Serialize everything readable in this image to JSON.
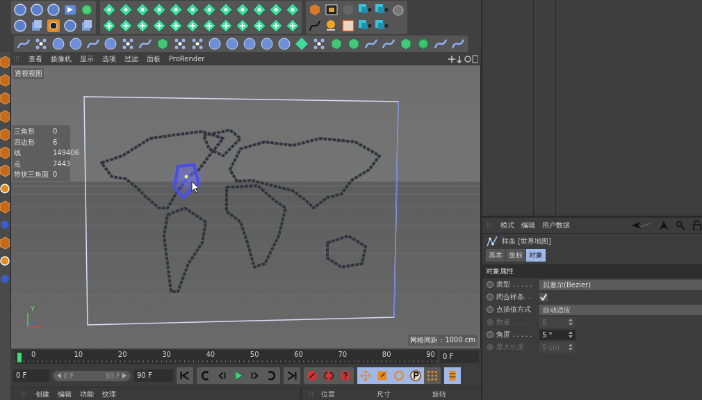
{
  "viewport": {
    "menu": [
      "查看",
      "摄像机",
      "显示",
      "选项",
      "过滤",
      "面板",
      "ProRender"
    ],
    "view_name": "透视视图",
    "stats": [
      {
        "label": "三角形",
        "value": "0"
      },
      {
        "label": "四边形",
        "value": "6"
      },
      {
        "label": "线",
        "value": "149406"
      },
      {
        "label": "点",
        "value": "7443"
      },
      {
        "label": "带状三角面",
        "value": "0"
      }
    ],
    "axis_label": "Y",
    "grid_spacing": "网格间距 : 1000 cm"
  },
  "timeline": {
    "ticks": [
      "0",
      "10",
      "20",
      "30",
      "40",
      "50",
      "60",
      "70",
      "80",
      "90"
    ],
    "frame_field": "0 F"
  },
  "transport": {
    "start_field": "0 F",
    "range": {
      "start": "0 F",
      "end": "90 F",
      "level": 1
    },
    "end_field": "90 F",
    "mode_buttons": [
      {
        "kind": "move",
        "selected": true
      },
      {
        "kind": "scale",
        "selected": true
      },
      {
        "kind": "rotate",
        "selected": true
      },
      {
        "kind": "param",
        "selected": true
      },
      {
        "kind": "dots",
        "selected": false
      }
    ]
  },
  "material_manager": {
    "menu": [
      "创建",
      "编辑",
      "功能",
      "纹理"
    ]
  },
  "coordinates": {
    "columns": [
      "位置",
      "尺寸",
      "旋转"
    ]
  },
  "attributes": {
    "menu": [
      "模式",
      "编辑",
      "用户数据"
    ],
    "object_title": "样条 [世界地图]",
    "tabs": [
      {
        "label": "基本",
        "selected": false
      },
      {
        "label": "坐标",
        "selected": false
      },
      {
        "label": "对象",
        "selected": true
      }
    ],
    "section": "对象属性",
    "properties": [
      {
        "kind": "dropdown",
        "label": "类型 . . . . .",
        "value": "贝塞尔(Bezier)",
        "disabled": false
      },
      {
        "kind": "checkbox",
        "label": "闭合样条. .",
        "checked": true,
        "disabled": false
      },
      {
        "kind": "dropdown",
        "label": "点插值方式",
        "value": "自动适应",
        "disabled": false
      },
      {
        "kind": "number",
        "label": "数量 . . . . .",
        "value": "8",
        "disabled": true
      },
      {
        "kind": "number",
        "label": "角度 . . . . .",
        "value": "5 °",
        "disabled": false
      },
      {
        "kind": "number",
        "label": "最大长度. .",
        "value": "5 cm",
        "disabled": true
      }
    ]
  }
}
